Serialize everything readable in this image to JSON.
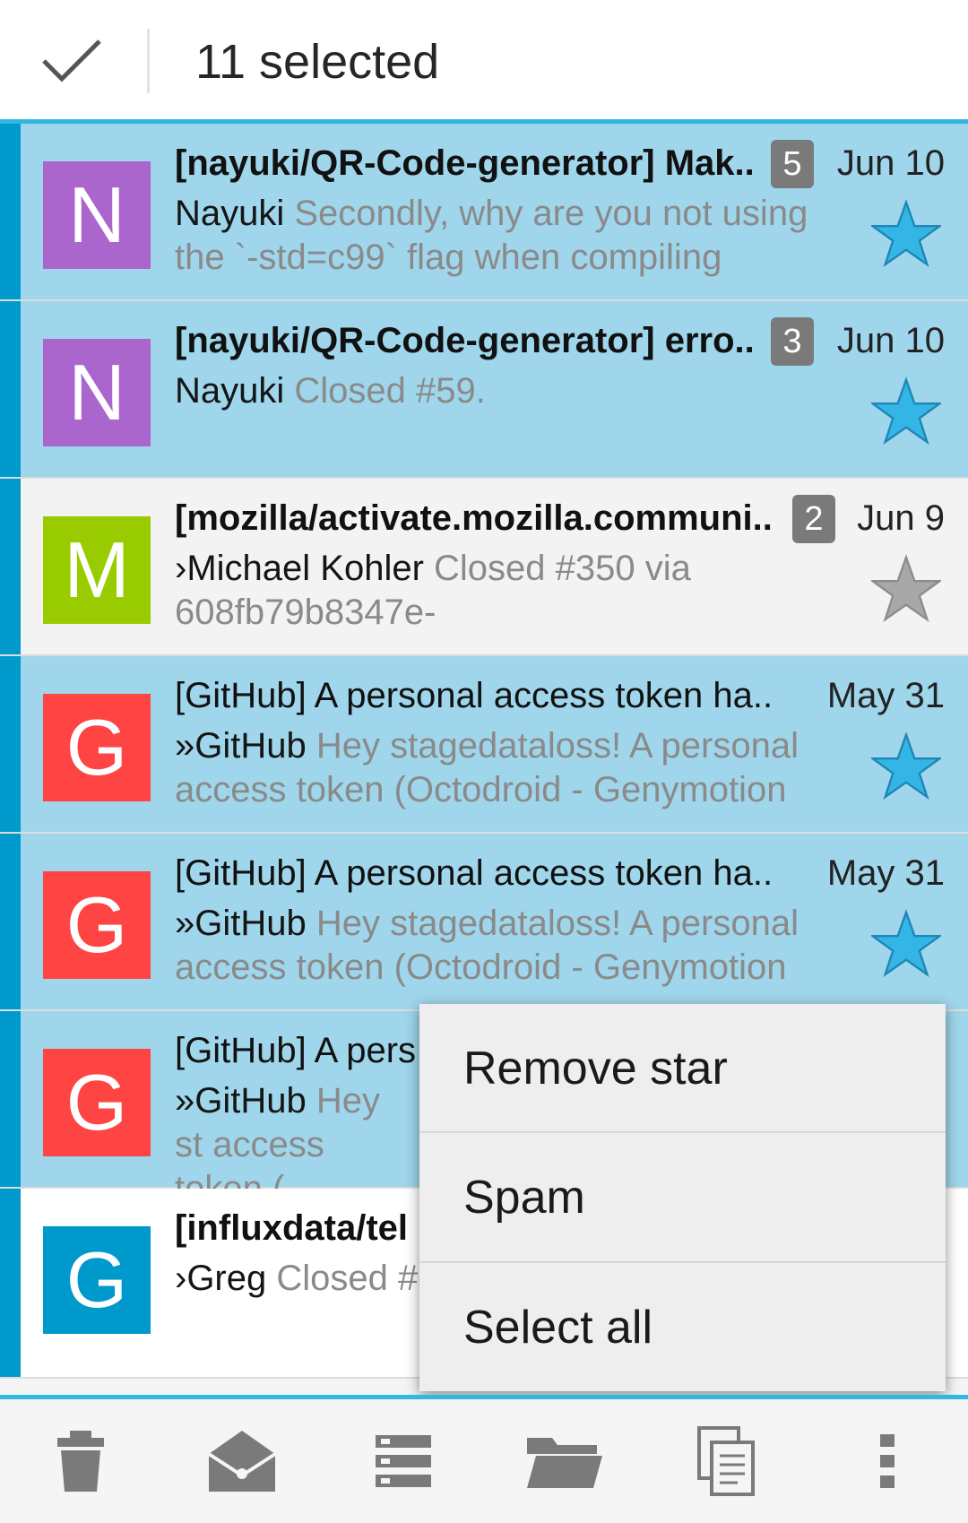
{
  "actionbar": {
    "title": "11 selected",
    "done_icon": "checkmark-icon"
  },
  "emails": [
    {
      "avatar_letter": "N",
      "avatar_color": "#aa66cc",
      "subject": "[nayuki/QR-Code-generator] Mak..",
      "bold": true,
      "count": "5",
      "date": "Jun 10",
      "sender": "Nayuki",
      "preview": " Secondly, why are you not using the `-std=c99` flag when compiling",
      "starred": true,
      "selected": true
    },
    {
      "avatar_letter": "N",
      "avatar_color": "#aa66cc",
      "subject": "[nayuki/QR-Code-generator] erro..",
      "bold": true,
      "count": "3",
      "date": "Jun 10",
      "sender": "Nayuki",
      "preview": " Closed #59.",
      "starred": true,
      "selected": true
    },
    {
      "avatar_letter": "M",
      "avatar_color": "#99cc00",
      "subject": "[mozilla/activate.mozilla.communi..",
      "bold": true,
      "count": "2",
      "date": "Jun 9",
      "sender": "›Michael Kohler",
      "preview": " Closed #350 via 608fb79b8347e-",
      "starred": false,
      "selected": false
    },
    {
      "avatar_letter": "G",
      "avatar_color": "#ff4444",
      "subject": "[GitHub] A personal access token ha..",
      "bold": false,
      "count": "",
      "date": "May 31",
      "sender": "»GitHub",
      "preview": " Hey stagedataloss! A personal access token (Octodroid - Genymotion",
      "starred": true,
      "selected": true
    },
    {
      "avatar_letter": "G",
      "avatar_color": "#ff4444",
      "subject": "[GitHub] A personal access token ha..",
      "bold": false,
      "count": "",
      "date": "May 31",
      "sender": "»GitHub",
      "preview": " Hey stagedataloss! A personal access token (Octodroid - Genymotion",
      "starred": true,
      "selected": true
    },
    {
      "avatar_letter": "G",
      "avatar_color": "#ff4444",
      "subject": "[GitHub] A pers",
      "bold": false,
      "count": "",
      "date": "",
      "sender": "»GitHub",
      "preview": " Hey st access token (",
      "starred": false,
      "selected": true
    },
    {
      "avatar_letter": "G",
      "avatar_color": "#0099cc",
      "subject": "[influxdata/tel",
      "bold": true,
      "count": "",
      "date": "",
      "sender": "›Greg",
      "preview": " Closed #",
      "starred": false,
      "selected": false
    }
  ],
  "popup_menu": {
    "items": [
      "Remove star",
      "Spam",
      "Select all"
    ]
  },
  "toolbar": {
    "icons": [
      "trash-icon",
      "mark-read-icon",
      "move-icon",
      "folder-icon",
      "copy-icon",
      "overflow-menu-icon"
    ]
  },
  "colors": {
    "accent": "#33b5e5",
    "selected_row": "#9fd6eb",
    "selection_edge": "#0099cc",
    "star_filled": "#33b5e5",
    "star_empty": "#a8a8a8"
  }
}
